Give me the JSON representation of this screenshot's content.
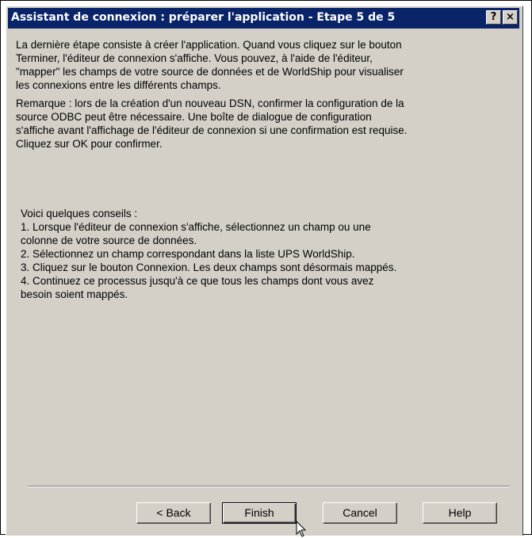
{
  "window": {
    "title": "Assistant de connexion : préparer l'application - Etape 5 de 5",
    "help_button": "?",
    "close_button": "×"
  },
  "content": {
    "paragraph1": "La dernière étape consiste à créer l'application. Quand vous cliquez sur le bouton\nTerminer, l'éditeur de connexion s'affiche. Vous pouvez, à l'aide de l'éditeur,\n\"mapper\" les champs de votre source de données et de WorldShip pour visualiser\nles connexions entre les différents champs.",
    "paragraph2": "Remarque : lors de la création d'un nouveau DSN, confirmer la configuration de la\nsource ODBC peut être nécessaire. Une boîte de dialogue de configuration\ns'affiche avant l'affichage de l'éditeur de connexion si une confirmation est requise.\n Cliquez sur OK pour confirmer.",
    "tips_intro": "Voici quelques conseils :",
    "tips": [
      "1. Lorsque l'éditeur de connexion s'affiche, sélectionnez un champ ou une\ncolonne de votre source de données.",
      "2. Sélectionnez un champ correspondant dans la liste UPS WorldShip.",
      "3. Cliquez sur le bouton Connexion. Les deux champs sont désormais mappés.",
      "4. Continuez ce processus jusqu'à ce que tous les champs dont vous avez\nbesoin soient mappés."
    ]
  },
  "buttons": {
    "back": "< Back",
    "finish": "Finish",
    "cancel": "Cancel",
    "help": "Help"
  },
  "colors": {
    "titlebar": "#0a246a",
    "dialog_face": "#d4d0c8"
  },
  "icons": {
    "cursor": "arrow-cursor-icon"
  }
}
